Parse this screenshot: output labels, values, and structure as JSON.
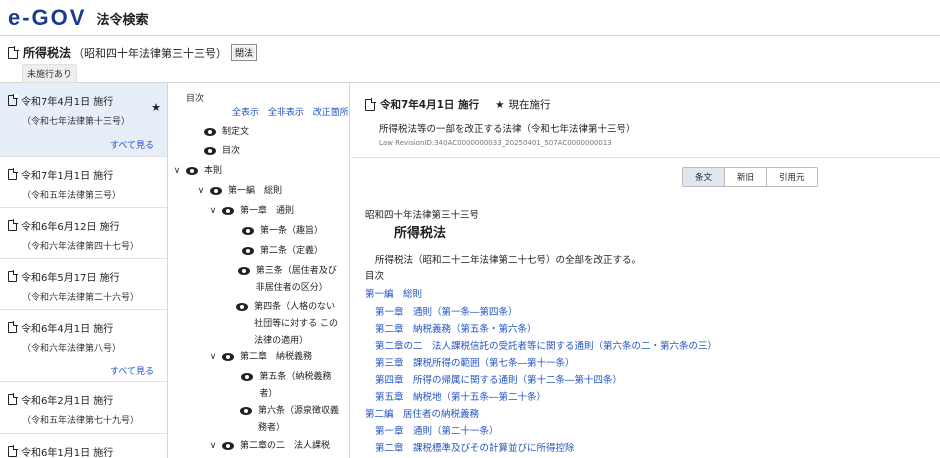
{
  "header": {
    "logo": "e-GOV",
    "app_name": "法令検索"
  },
  "law": {
    "name": "所得税法",
    "number": "（昭和四十年法律第三十三号）",
    "close_label": "閉法",
    "status_badge": "未施行あり"
  },
  "history": {
    "see_all_label": "すべて見る",
    "items": [
      {
        "date": "令和7年4月1日 施行",
        "law": "（令和七年法律第十三号）"
      },
      {
        "date": "令和7年1月1日 施行",
        "law": "（令和五年法律第三号）"
      },
      {
        "date": "令和6年6月12日 施行",
        "law": "（令和六年法律第四十七号）"
      },
      {
        "date": "令和6年5月17日 施行",
        "law": "（令和六年法律第二十六号）"
      },
      {
        "date": "令和6年4月1日 施行",
        "law": "（令和六年法律第八号）"
      },
      {
        "date": "令和6年2月1日 施行",
        "law": "（令和五年法律第七十九号）"
      },
      {
        "date": "令和6年1月1日 施行",
        "law": ""
      }
    ]
  },
  "toc": {
    "title": "目次",
    "links": [
      "全表示",
      "全非表示",
      "改正箇所"
    ],
    "rows": [
      {
        "chev": "",
        "label": "制定文"
      },
      {
        "chev": "",
        "label": "目次"
      },
      {
        "chev": "∨",
        "label": "本則"
      },
      {
        "chev": "∨",
        "label": "第一編　総則"
      },
      {
        "chev": "∨",
        "label": "第一章　通則"
      },
      {
        "chev": "",
        "label": "第一条（趣旨）"
      },
      {
        "chev": "",
        "label": "第二条（定義）"
      },
      {
        "chev": "",
        "label": "第三条（居住者及び非居住者の区分）"
      },
      {
        "chev": "",
        "label": "第四条（人格のない社団等に対する この法律の適用）"
      },
      {
        "chev": "∨",
        "label": "第二章　納税義務"
      },
      {
        "chev": "",
        "label": "第五条（納税義務者）"
      },
      {
        "chev": "",
        "label": "第六条（源泉徴収義務者）"
      },
      {
        "chev": "∨",
        "label": "第二章の二　法人課税"
      }
    ]
  },
  "main": {
    "revision_date": "令和7年4月1日 施行",
    "current_label": "現在施行",
    "revision_desc": "所得税法等の一部を改正する法律（令和七年法律第十三号）",
    "revision_id": "Law RevisionID:340AC0000000033_20250401_507AC0000000013",
    "tabs": [
      "条文",
      "新旧",
      "引用元"
    ],
    "law_number": "昭和四十年法律第三十三号",
    "law_name": "所得税法",
    "preamble": "所得税法（昭和二十二年法律第二十七号）の全部を改正する。",
    "toc_heading": "目次",
    "toc_lines": [
      "第一編　総則",
      "第一章　通則（第一条―第四条）",
      "第二章　納税義務（第五条・第六条）",
      "第二章の二　法人課税信託の受託者等に関する通則（第六条の二・第六条の三）",
      "第三章　課税所得の範囲（第七条―第十一条）",
      "第四章　所得の帰属に関する通則（第十二条―第十四条）",
      "第五章　納税地（第十五条―第二十条）",
      "第二編　居住者の納税義務",
      "第一章　通則（第二十一条）",
      "第二章　課税標準及びその計算並びに所得控除"
    ]
  }
}
